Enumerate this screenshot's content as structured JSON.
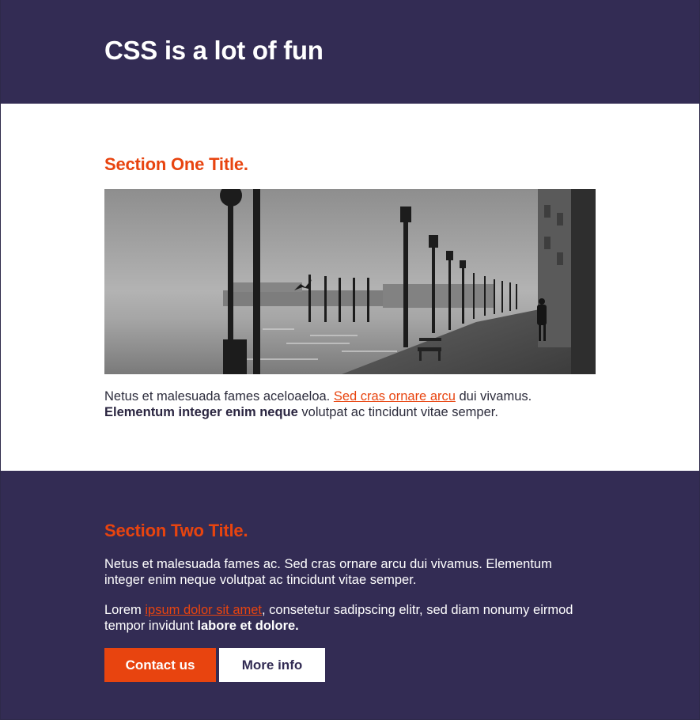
{
  "header": {
    "title": "CSS is a lot of fun"
  },
  "section_one": {
    "title": "Section One Title.",
    "paragraph": {
      "text_before": "Netus et malesuada fames aceloaeloa. ",
      "link": "Sed cras ornare arcu",
      "text_after": " dui vivamus.",
      "bold": "Elementum integer enim neque",
      "text_end": " volutpat ac tincidunt vitae semper."
    }
  },
  "section_two": {
    "title": "Section Two Title.",
    "paragraph1": "Netus et malesuada fames ac. Sed cras ornare arcu dui vivamus. Elementum integer enim neque volutpat ac tincidunt vitae semper.",
    "paragraph2": {
      "text_before": "Lorem ",
      "link": "ipsum dolor sit amet",
      "text_after": ", consetetur sadipscing elitr, sed diam nonumy eirmod tempor invidunt ",
      "bold": "labore et dolore."
    },
    "buttons": {
      "contact": "Contact us",
      "more": "More info"
    }
  },
  "colors": {
    "navy": "#332c54",
    "accent": "#e8440f",
    "white": "#ffffff"
  }
}
